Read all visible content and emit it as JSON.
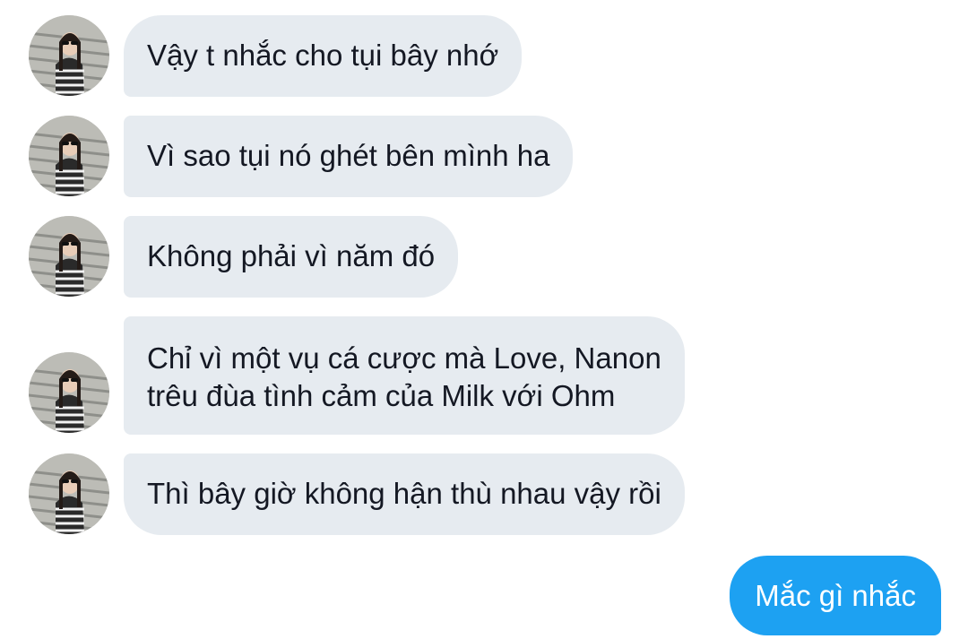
{
  "conversation": {
    "received": [
      {
        "text": "Vậy t nhắc cho tụi bây nhớ",
        "avatar": "contact-avatar"
      },
      {
        "text": "Vì sao tụi nó ghét bên mình ha",
        "avatar": "contact-avatar"
      },
      {
        "text": "Không phải vì năm đó",
        "avatar": "contact-avatar"
      },
      {
        "text": "Chỉ vì một vụ cá cược mà Love, Nanon\ntrêu đùa tình cảm của Milk với Ohm",
        "avatar": "contact-avatar"
      },
      {
        "text": "Thì bây giờ không hận thù nhau vậy rồi",
        "avatar": "contact-avatar"
      }
    ],
    "sent": [
      {
        "text": "Mắc gì nhắc"
      }
    ]
  },
  "colors": {
    "received_bubble": "#e6ebf0",
    "sent_bubble": "#1da1f2",
    "received_text": "#141823",
    "sent_text": "#ffffff"
  }
}
